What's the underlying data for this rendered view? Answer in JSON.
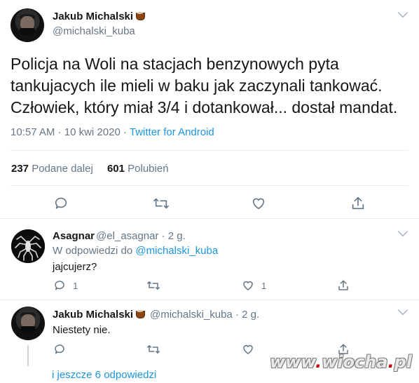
{
  "main_tweet": {
    "author_name": "Jakub Michalski",
    "author_handle": "@michalski_kuba",
    "text": "Policja na Woli na stacjach benzynowych pyta tankujacych ile mieli w baku jak zaczynali tankować. Człowiek, który miał 3/4 i dotankował... dostał mandat.",
    "time": "10:57 AM",
    "date": "10 kwi 2020",
    "separator": "·",
    "source": "Twitter for Android",
    "retweets_count": "237",
    "retweets_label": "Podane dalej",
    "likes_count": "601",
    "likes_label": "Polubień",
    "icons": [
      "reply-icon",
      "retweet-icon",
      "like-icon",
      "share-icon"
    ]
  },
  "replies": [
    {
      "author_name": "Asagnar",
      "author_handle": "@el_asagnar",
      "age": "2 g.",
      "replying_prefix": "W odpowiedzi do",
      "replying_to": "@michalski_kuba",
      "text": "jajcujerz?",
      "reply_count": "1",
      "retweet_count": "",
      "like_count": "1"
    },
    {
      "author_name": "Jakub Michalski",
      "author_handle": "@michalski_kuba",
      "age": "2 g.",
      "text": "Niestety nie.",
      "reply_count": "",
      "retweet_count": "",
      "like_count": ""
    }
  ],
  "more_replies": "i jeszcze 6 odpowiedzi",
  "watermark": {
    "part1": "www",
    "dot1": ".",
    "part2": "wiocha",
    "dot2": ".",
    "part3": "pl"
  },
  "colors": {
    "link": "#1b95e0",
    "muted": "#657786",
    "text": "#14171a",
    "divider": "#e6ecf0"
  }
}
